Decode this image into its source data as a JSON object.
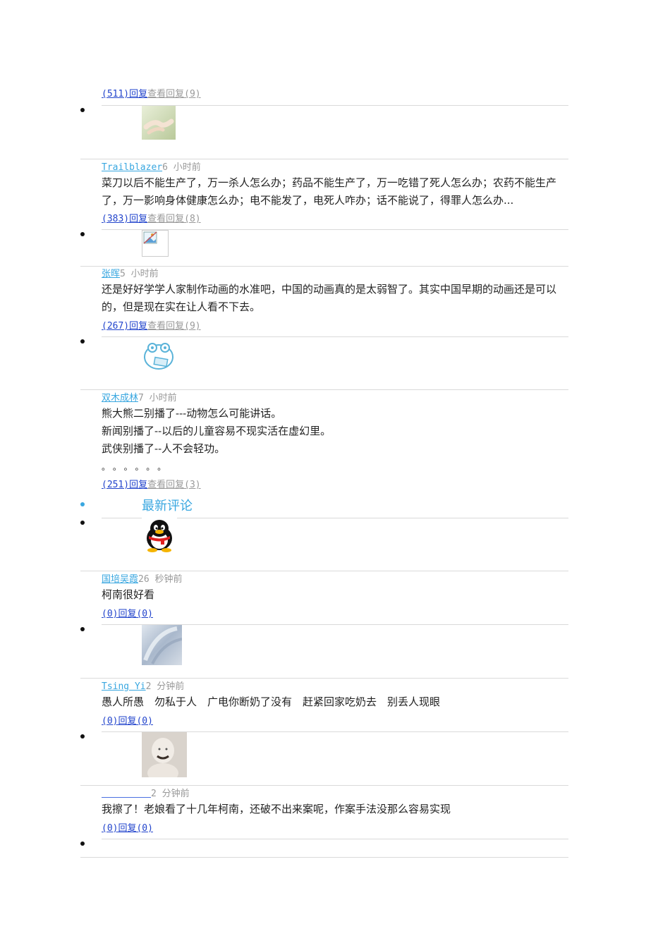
{
  "comments": [
    {
      "reply_label": "(511)回复",
      "view_label": "查看回复(9)"
    },
    {
      "name": "Trailblazer",
      "time": "6 小时前",
      "text": "菜刀以后不能生产了，万一杀人怎么办；药品不能生产了，万一吃错了死人怎么办；农药不能生产了，万一影响身体健康怎么办；电不能发了，电死人咋办；话不能说了，得罪人怎么办...",
      "reply_label": "(383)回复",
      "view_label": "查看回复(8)"
    },
    {
      "name": "张晖",
      "time": "5 小时前",
      "text": "还是好好学学人家制作动画的水准吧，中国的动画真的是太弱智了。其实中国早期的动画还是可以的，但是现在实在让人看不下去。",
      "reply_label": "(267)回复",
      "view_label": "查看回复(9)"
    },
    {
      "name": "双木成林",
      "time": "7 小时前",
      "lines": [
        "熊大熊二别播了---动物怎么可能讲话。",
        "新闻别播了--以后的儿童容易不现实活在虚幻里。",
        "武侠别播了--人不会轻功。",
        "。 。 。 。 。 。"
      ],
      "reply_label": "(251)回复",
      "view_label": "查看回复(3)"
    }
  ],
  "latest_title": "最新评论",
  "latest": [
    {
      "name": "国培吴霞",
      "time": "26 秒钟前",
      "text": "柯南很好看",
      "reply_label": "(0)回复(0)"
    },
    {
      "name": "Tsing Yi",
      "time": "2 分钟前",
      "text": "愚人所愚　勿私于人　广电你断奶了没有　赶紧回家吃奶去　别丢人现眼",
      "reply_label": "(0)回复(0)"
    },
    {
      "name": "",
      "time": "2 分钟前",
      "text": "我擦了！老娘看了十几年柯南，还破不出来案呢，作案手法没那么容易实现",
      "reply_label": "(0)回复(0)"
    }
  ],
  "colors": {
    "link_blue": "#39a7e0",
    "reply_blue": "#2244cc",
    "gray": "#999999",
    "rule": "#dadada"
  },
  "icons": [
    "hands-photo-avatar",
    "broken-image-icon",
    "cartoon-frog-avatar",
    "qq-penguin-avatar",
    "blurry-photo-avatar",
    "person-photo-avatar"
  ]
}
